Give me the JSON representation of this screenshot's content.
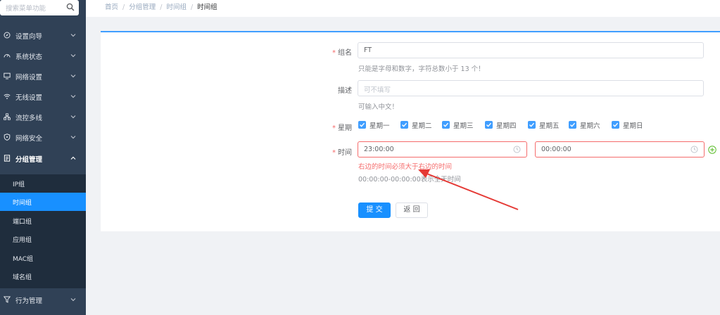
{
  "sidebar": {
    "search_placeholder": "搜索菜单功能",
    "items": [
      {
        "label": "设置向导",
        "icon": "compass-icon"
      },
      {
        "label": "系统状态",
        "icon": "gauge-icon"
      },
      {
        "label": "网络设置",
        "icon": "monitor-icon"
      },
      {
        "label": "无线设置",
        "icon": "wifi-icon"
      },
      {
        "label": "流控多线",
        "icon": "network-icon"
      },
      {
        "label": "网络安全",
        "icon": "shield-icon"
      },
      {
        "label": "分组管理",
        "icon": "document-icon"
      },
      {
        "label": "行为管理",
        "icon": "filter-icon"
      }
    ],
    "submenu": [
      "IP组",
      "时间组",
      "端口组",
      "应用组",
      "MAC组",
      "域名组"
    ]
  },
  "breadcrumb": [
    "首页",
    "分组管理",
    "时间组",
    "时间组"
  ],
  "form": {
    "name_label": "组名",
    "name_value": "FT",
    "name_hint": "只能是字母和数字，字符总数小于 13 个！",
    "desc_label": "描述",
    "desc_placeholder": "可不填写",
    "desc_hint": "可输入中文！",
    "week_label": "星期",
    "days": [
      "星期一",
      "星期二",
      "星期三",
      "星期四",
      "星期五",
      "星期六",
      "星期日"
    ],
    "time_label": "时间",
    "start_time": "23:00:00",
    "end_time": "00:00:00",
    "time_error": "右边的时间必须大于右边的时间",
    "time_hint": "00:00:00-00:00:00表示全天时间",
    "submit_label": "提 交",
    "back_label": "返 回"
  },
  "colors": {
    "primary": "#1890ff",
    "error": "#f56c6c",
    "annotation": "#e53935"
  }
}
